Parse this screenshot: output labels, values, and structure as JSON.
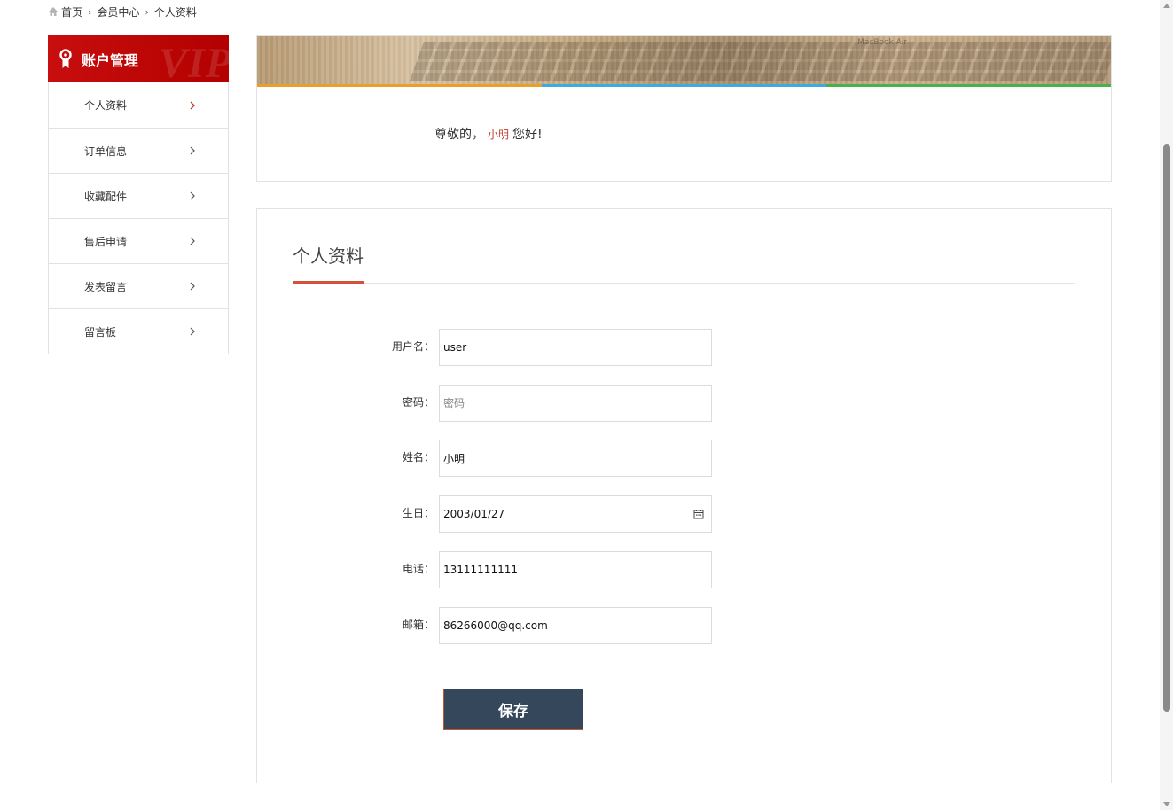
{
  "breadcrumb": {
    "icon": "home-icon",
    "items": [
      "首页",
      "会员中心",
      "个人资料"
    ]
  },
  "sidebar": {
    "title": "账户管理",
    "watermark": "VIP",
    "icon": "award-icon",
    "items": [
      {
        "label": "个人资料",
        "active": true
      },
      {
        "label": "订单信息",
        "active": false
      },
      {
        "label": "收藏配件",
        "active": false
      },
      {
        "label": "售后申请",
        "active": false
      },
      {
        "label": "发表留言",
        "active": false
      },
      {
        "label": "留言板",
        "active": false
      }
    ]
  },
  "welcome": {
    "prefix": "尊敬的，",
    "name": "小明",
    "suffix": "您好!",
    "banner_caption": "MacBook Air",
    "color_bar": [
      "#e8a02a",
      "#3fa9e0",
      "#48b04c"
    ]
  },
  "profile": {
    "title": "个人资料",
    "fields": {
      "username": {
        "label": "用户名：",
        "value": "user"
      },
      "password": {
        "label": "密码：",
        "placeholder": "密码"
      },
      "name": {
        "label": "姓名：",
        "value": "小明"
      },
      "birthday": {
        "label": "生日：",
        "value": "2003/01/27",
        "icon": "calendar-icon"
      },
      "phone": {
        "label": "电话：",
        "value": "13111111111"
      },
      "email": {
        "label": "邮箱：",
        "value": "86266000@qq.com"
      }
    },
    "save_label": "保存"
  },
  "colors": {
    "brand_red": "#c80e0e",
    "accent_underline": "#d2513b",
    "button_bg": "#35475b",
    "name_highlight": "#c0392b"
  }
}
